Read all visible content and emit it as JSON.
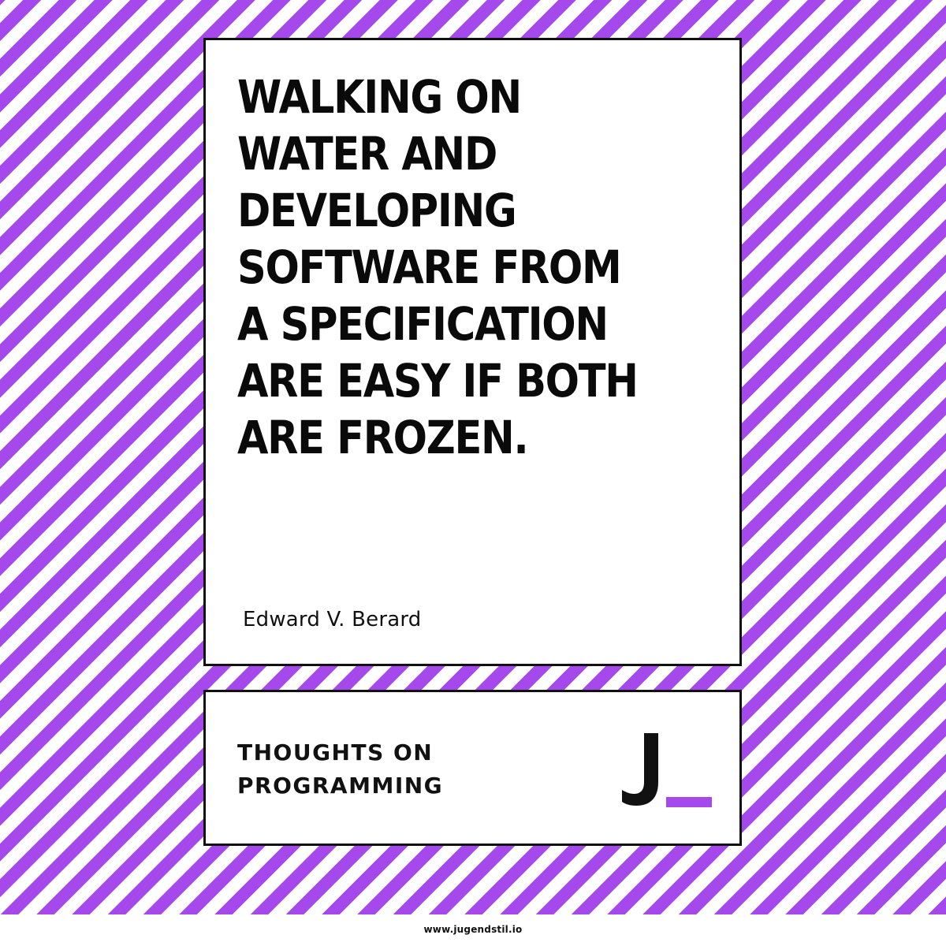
{
  "quote": {
    "lines": [
      "WALKING ON",
      "WATER AND",
      "DEVELOPING",
      "SOFTWARE FROM",
      "A SPECIFICATION",
      "ARE EASY IF BOTH",
      "ARE FROZEN."
    ],
    "author": "Edward V. Berard"
  },
  "series": {
    "lines": [
      "THOUGHTS ON",
      "PROGRAMMING"
    ]
  },
  "brand": {
    "logo_icon": "jugendstil-j-underscore-logo",
    "website": "www.jugendstil.io"
  },
  "colors": {
    "accent": "#a549ed",
    "ink": "#111111",
    "background": "#ffffff"
  }
}
